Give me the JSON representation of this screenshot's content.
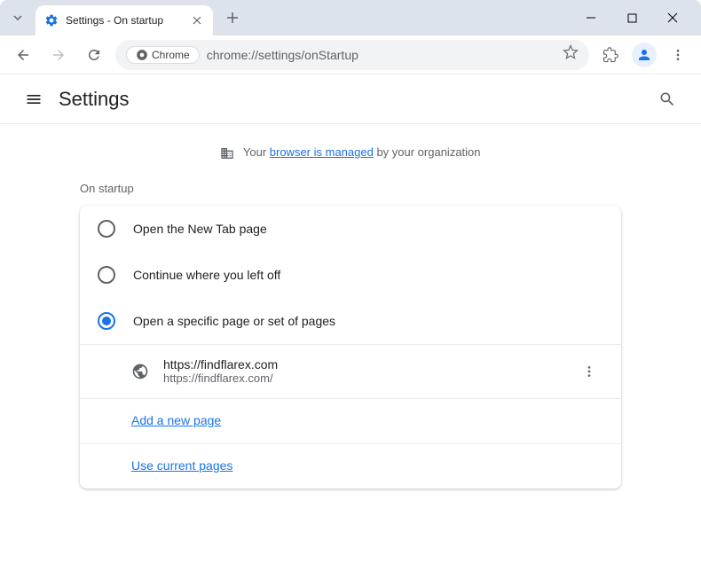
{
  "window": {
    "tab_title": "Settings - On startup"
  },
  "toolbar": {
    "chip_label": "Chrome",
    "url": "chrome://settings/onStartup"
  },
  "settings": {
    "title": "Settings"
  },
  "managed": {
    "prefix": "Your ",
    "link": "browser is managed",
    "suffix": " by your organization"
  },
  "section": {
    "title": "On startup"
  },
  "options": {
    "new_tab": "Open the New Tab page",
    "continue": "Continue where you left off",
    "specific": "Open a specific page or set of pages"
  },
  "page": {
    "name": "https://findflarex.com",
    "url": "https://findflarex.com/"
  },
  "actions": {
    "add_page": "Add a new page",
    "use_current": "Use current pages"
  }
}
